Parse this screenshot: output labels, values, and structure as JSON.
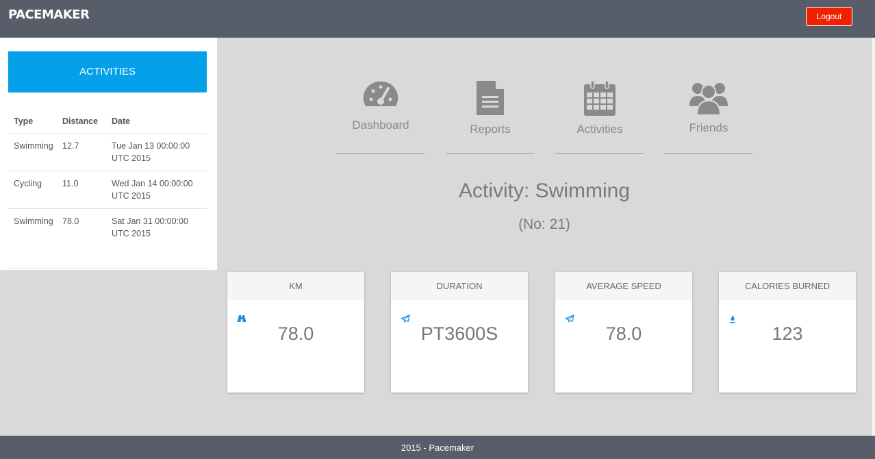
{
  "header": {
    "brand": "PACEMAKER",
    "logout_label": "Logout"
  },
  "sidebar": {
    "title": "ACTIVITIES",
    "columns": [
      "Type",
      "Distance",
      "Date"
    ],
    "rows": [
      {
        "type": "Swimming",
        "distance": "12.7",
        "date": "Tue Jan 13 00:00:00 UTC 2015"
      },
      {
        "type": "Cycling",
        "distance": "11.0",
        "date": "Wed Jan 14 00:00:00 UTC 2015"
      },
      {
        "type": "Swimming",
        "distance": "78.0",
        "date": "Sat Jan 31 00:00:00 UTC 2015"
      }
    ]
  },
  "nav": [
    {
      "label": "Dashboard",
      "icon": "dashboard-gauge-icon"
    },
    {
      "label": "Reports",
      "icon": "document-icon"
    },
    {
      "label": "Activities",
      "icon": "calendar-icon"
    },
    {
      "label": "Friends",
      "icon": "users-group-icon"
    }
  ],
  "activity": {
    "title": "Activity: Swimming",
    "number": "(No: 21)"
  },
  "stats": [
    {
      "label": "KM",
      "value": "78.0",
      "icon": "road-icon"
    },
    {
      "label": "DURATION",
      "value": "PT3600S",
      "icon": "paper-plane-icon"
    },
    {
      "label": "AVERAGE SPEED",
      "value": "78.0",
      "icon": "paper-plane-icon"
    },
    {
      "label": "CALORIES BURNED",
      "value": "123",
      "icon": "fire-icon"
    }
  ],
  "footer": {
    "text": "2015 - Pacemaker"
  },
  "colors": {
    "topbar": "#575e69",
    "accent": "#04a1ea",
    "logout": "#ee2200",
    "icon_blue": "#2b8fd6"
  }
}
